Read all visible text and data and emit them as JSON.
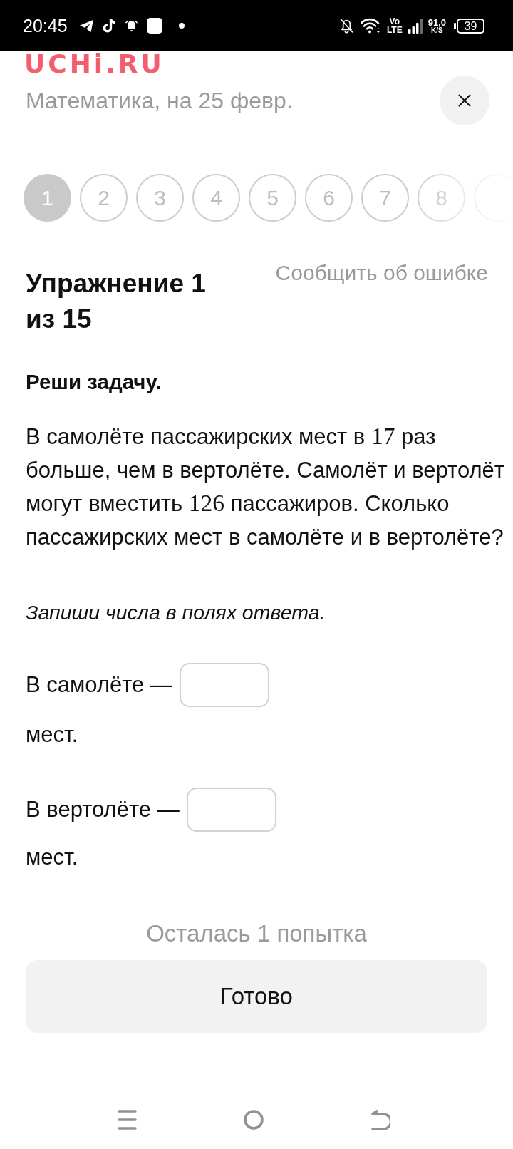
{
  "status_bar": {
    "time": "20:45",
    "network": {
      "top": "Vo",
      "bottom": "LTE"
    },
    "speed": {
      "value": "91,0",
      "unit": "K/S"
    },
    "battery": "39"
  },
  "header": {
    "logo": "UCHi.RU",
    "subtitle": "Математика, на 25 февр."
  },
  "steps": [
    {
      "label": "1",
      "selected": true
    },
    {
      "label": "2",
      "selected": false
    },
    {
      "label": "3",
      "selected": false
    },
    {
      "label": "4",
      "selected": false
    },
    {
      "label": "5",
      "selected": false
    },
    {
      "label": "6",
      "selected": false
    },
    {
      "label": "7",
      "selected": false
    },
    {
      "label": "8",
      "selected": false
    },
    {
      "selected": false
    }
  ],
  "exercise": {
    "title": "Упражнение 1 из 15",
    "report_link": "Сообщить об ошибке"
  },
  "task": {
    "instruction": "Реши задачу.",
    "text": [
      {
        "kind": "text",
        "text": "В самолёте пассажирских мест в "
      },
      {
        "kind": "math",
        "text": "17"
      },
      {
        "kind": "text",
        "text": " раз больше, чем в вертолёте. Самолёт и вертолёт могут вместить "
      },
      {
        "kind": "math",
        "text": "126"
      },
      {
        "kind": "text",
        "text": " пассажиров. Сколько пассажирских мест в самолёте и в вертолёте?"
      }
    ],
    "hint": "Запиши числа в полях ответа."
  },
  "answers": [
    {
      "label": "В самолёте —",
      "unit": "мест."
    },
    {
      "label": "В вертолёте —",
      "unit": "мест."
    }
  ],
  "attempts": "Осталась 1 попытка",
  "submit": "Готово"
}
